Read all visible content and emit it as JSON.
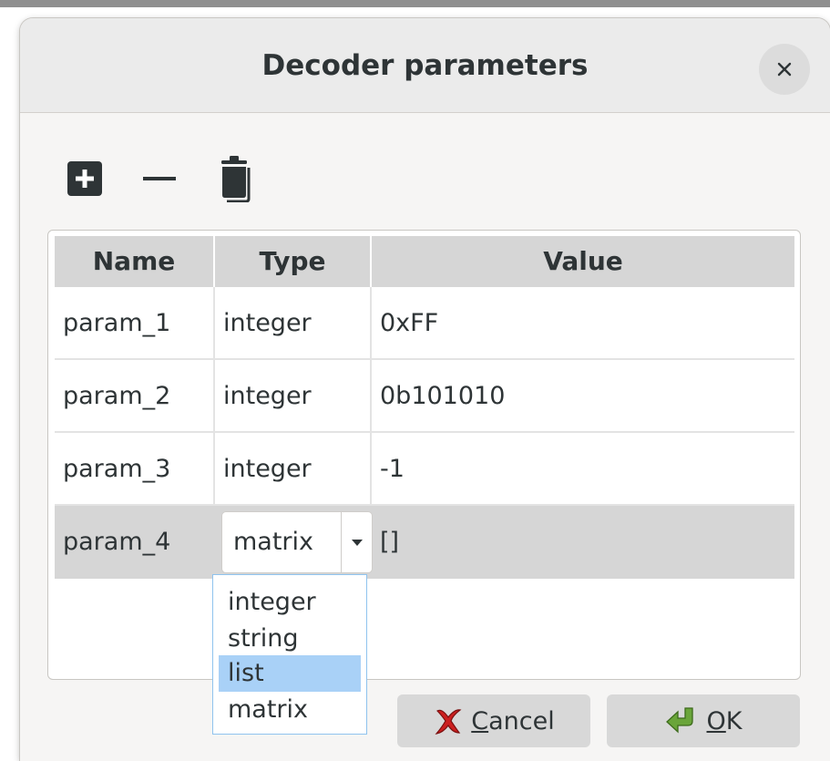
{
  "dialog": {
    "title": "Decoder parameters"
  },
  "toolbar": {
    "items": [
      {
        "icon": "add-icon"
      },
      {
        "icon": "remove-icon"
      },
      {
        "icon": "trash-icon"
      }
    ]
  },
  "table": {
    "columns": [
      "Name",
      "Type",
      "Value"
    ],
    "rows": [
      {
        "name": "param_1",
        "type": "integer",
        "value": "0xFF"
      },
      {
        "name": "param_2",
        "type": "integer",
        "value": "0b101010"
      },
      {
        "name": "param_3",
        "type": "integer",
        "value": "-1"
      },
      {
        "name": "param_4",
        "type": "matrix",
        "value": "[]"
      }
    ],
    "selected_row": 4
  },
  "type_dropdown": {
    "selected": "matrix",
    "highlighted": "list",
    "options": [
      "integer",
      "string",
      "list",
      "matrix"
    ]
  },
  "buttons": {
    "cancel": {
      "mnemonic": "C",
      "rest": "ancel",
      "icon": "red-x-icon"
    },
    "ok": {
      "mnemonic": "O",
      "rest": "K",
      "icon": "green-arrow-icon"
    }
  },
  "colors": {
    "selection_row": "#d6d6d6",
    "popup_highlight": "#a9d1f7",
    "popup_border": "#8fc3ee",
    "cancel_icon": "#cc1f1f",
    "ok_icon": "#6aa53a"
  }
}
